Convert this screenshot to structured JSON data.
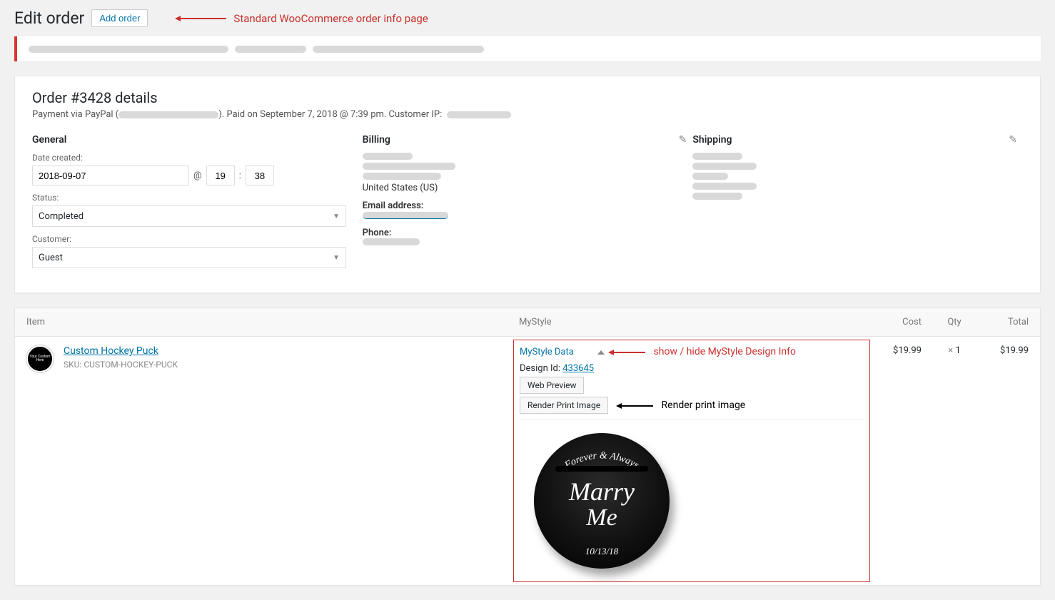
{
  "header": {
    "title": "Edit order",
    "add_order": "Add order",
    "annotation": "Standard WooCommerce order info page"
  },
  "order": {
    "title": "Order #3428 details",
    "meta_prefix": "Payment via PayPal (",
    "meta_suffix": "). Paid on September 7, 2018 @ 7:39 pm. Customer IP:"
  },
  "general": {
    "heading": "General",
    "date_label": "Date created:",
    "date_value": "2018-09-07",
    "at": "@",
    "hour": "19",
    "minute": "38",
    "colon": ":",
    "status_label": "Status:",
    "status_value": "Completed",
    "customer_label": "Customer:",
    "customer_value": "Guest"
  },
  "billing": {
    "heading": "Billing",
    "country": "United States (US)",
    "email_label": "Email address:",
    "phone_label": "Phone:"
  },
  "shipping": {
    "heading": "Shipping"
  },
  "table": {
    "headers": {
      "item": "Item",
      "mystyle": "MyStyle",
      "cost": "Cost",
      "qty": "Qty",
      "total": "Total"
    }
  },
  "item": {
    "thumb_text": "Your Custom Here",
    "name": "Custom Hockey Puck",
    "sku_label": "SKU:",
    "sku": "CUSTOM-HOCKEY-PUCK",
    "cost": "$19.99",
    "qty_prefix": "×",
    "qty": "1",
    "total": "$19.99"
  },
  "mystyle": {
    "toggle": "MyStyle Data",
    "annotation": "show / hide MyStyle Design Info",
    "design_id_label": "Design Id:",
    "design_id": "433645",
    "web_preview": "Web Preview",
    "render_print": "Render Print Image",
    "render_annotation": "Render print image",
    "puck_top": "Forever & Always",
    "puck_main1": "Marry",
    "puck_main2": "Me",
    "puck_date": "10/13/18"
  }
}
